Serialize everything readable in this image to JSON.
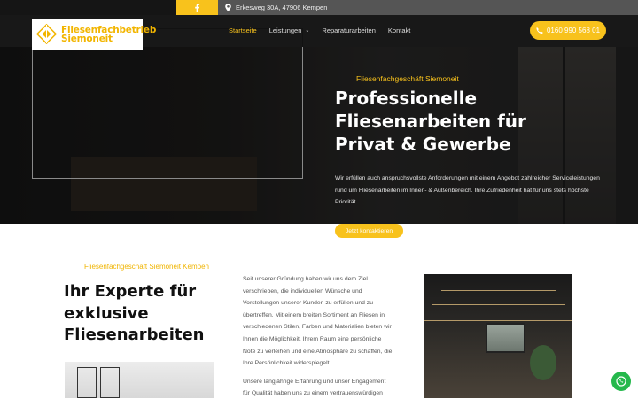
{
  "topbar": {
    "address": "Erkesweg 30A, 47906 Kempen",
    "facebook_icon": "facebook-icon",
    "location_icon": "map-pin-icon"
  },
  "header": {
    "logo_line1": "Fliesenfachbetrieb",
    "logo_line2": "Siemoneit",
    "nav": [
      {
        "label": "Startseite",
        "active": true
      },
      {
        "label": "Leistungen",
        "dropdown": true
      },
      {
        "label": "Reparaturarbeiten"
      },
      {
        "label": "Kontakt"
      }
    ],
    "phone": "0160 990 568 01",
    "phone_icon": "phone-icon"
  },
  "hero": {
    "eyebrow": "Fliesenfachgeschäft Siemoneit",
    "title_line1": "Professionelle",
    "title_line2": "Fliesenarbeiten für",
    "title_line3": "Privat & Gewerbe",
    "text": "Wir erfüllen auch anspruchsvollste Anforderungen mit einem Angebot zahlreicher Serviceleistungen rund um Fliesenarbeiten im Innen- & Außenbereich. Ihre Zufriedenheit hat für uns stets höchste Priorität.",
    "cta": "Jetzt kontaktieren"
  },
  "about": {
    "eyebrow": "Fliesenfachgeschäft Siemoneit Kempen",
    "title_line1": "Ihr Experte für",
    "title_line2": "exklusive",
    "title_line3": "Fliesenarbeiten",
    "paragraph1": "Seit unserer Gründung haben wir uns dem Ziel verschrieben, die individuellen Wünsche und Vorstellungen unserer Kunden zu erfüllen und zu übertreffen. Mit einem breiten Sortiment an Fliesen in verschiedenen Stilen, Farben und Materialien bieten wir Ihnen die Möglichkeit, Ihrem Raum eine persönliche Note zu verleihen und eine Atmosphäre zu schaffen, die Ihre Persönlichkeit widerspiegelt.",
    "paragraph2": "Unsere langjährige Erfahrung und unser Engagement für Qualität haben uns zu einem vertrauenswürdigen"
  },
  "floating": {
    "whatsapp_icon": "whatsapp-icon"
  },
  "colors": {
    "accent": "#f8c21c",
    "dark": "#151515",
    "whatsapp": "#25b84c"
  }
}
